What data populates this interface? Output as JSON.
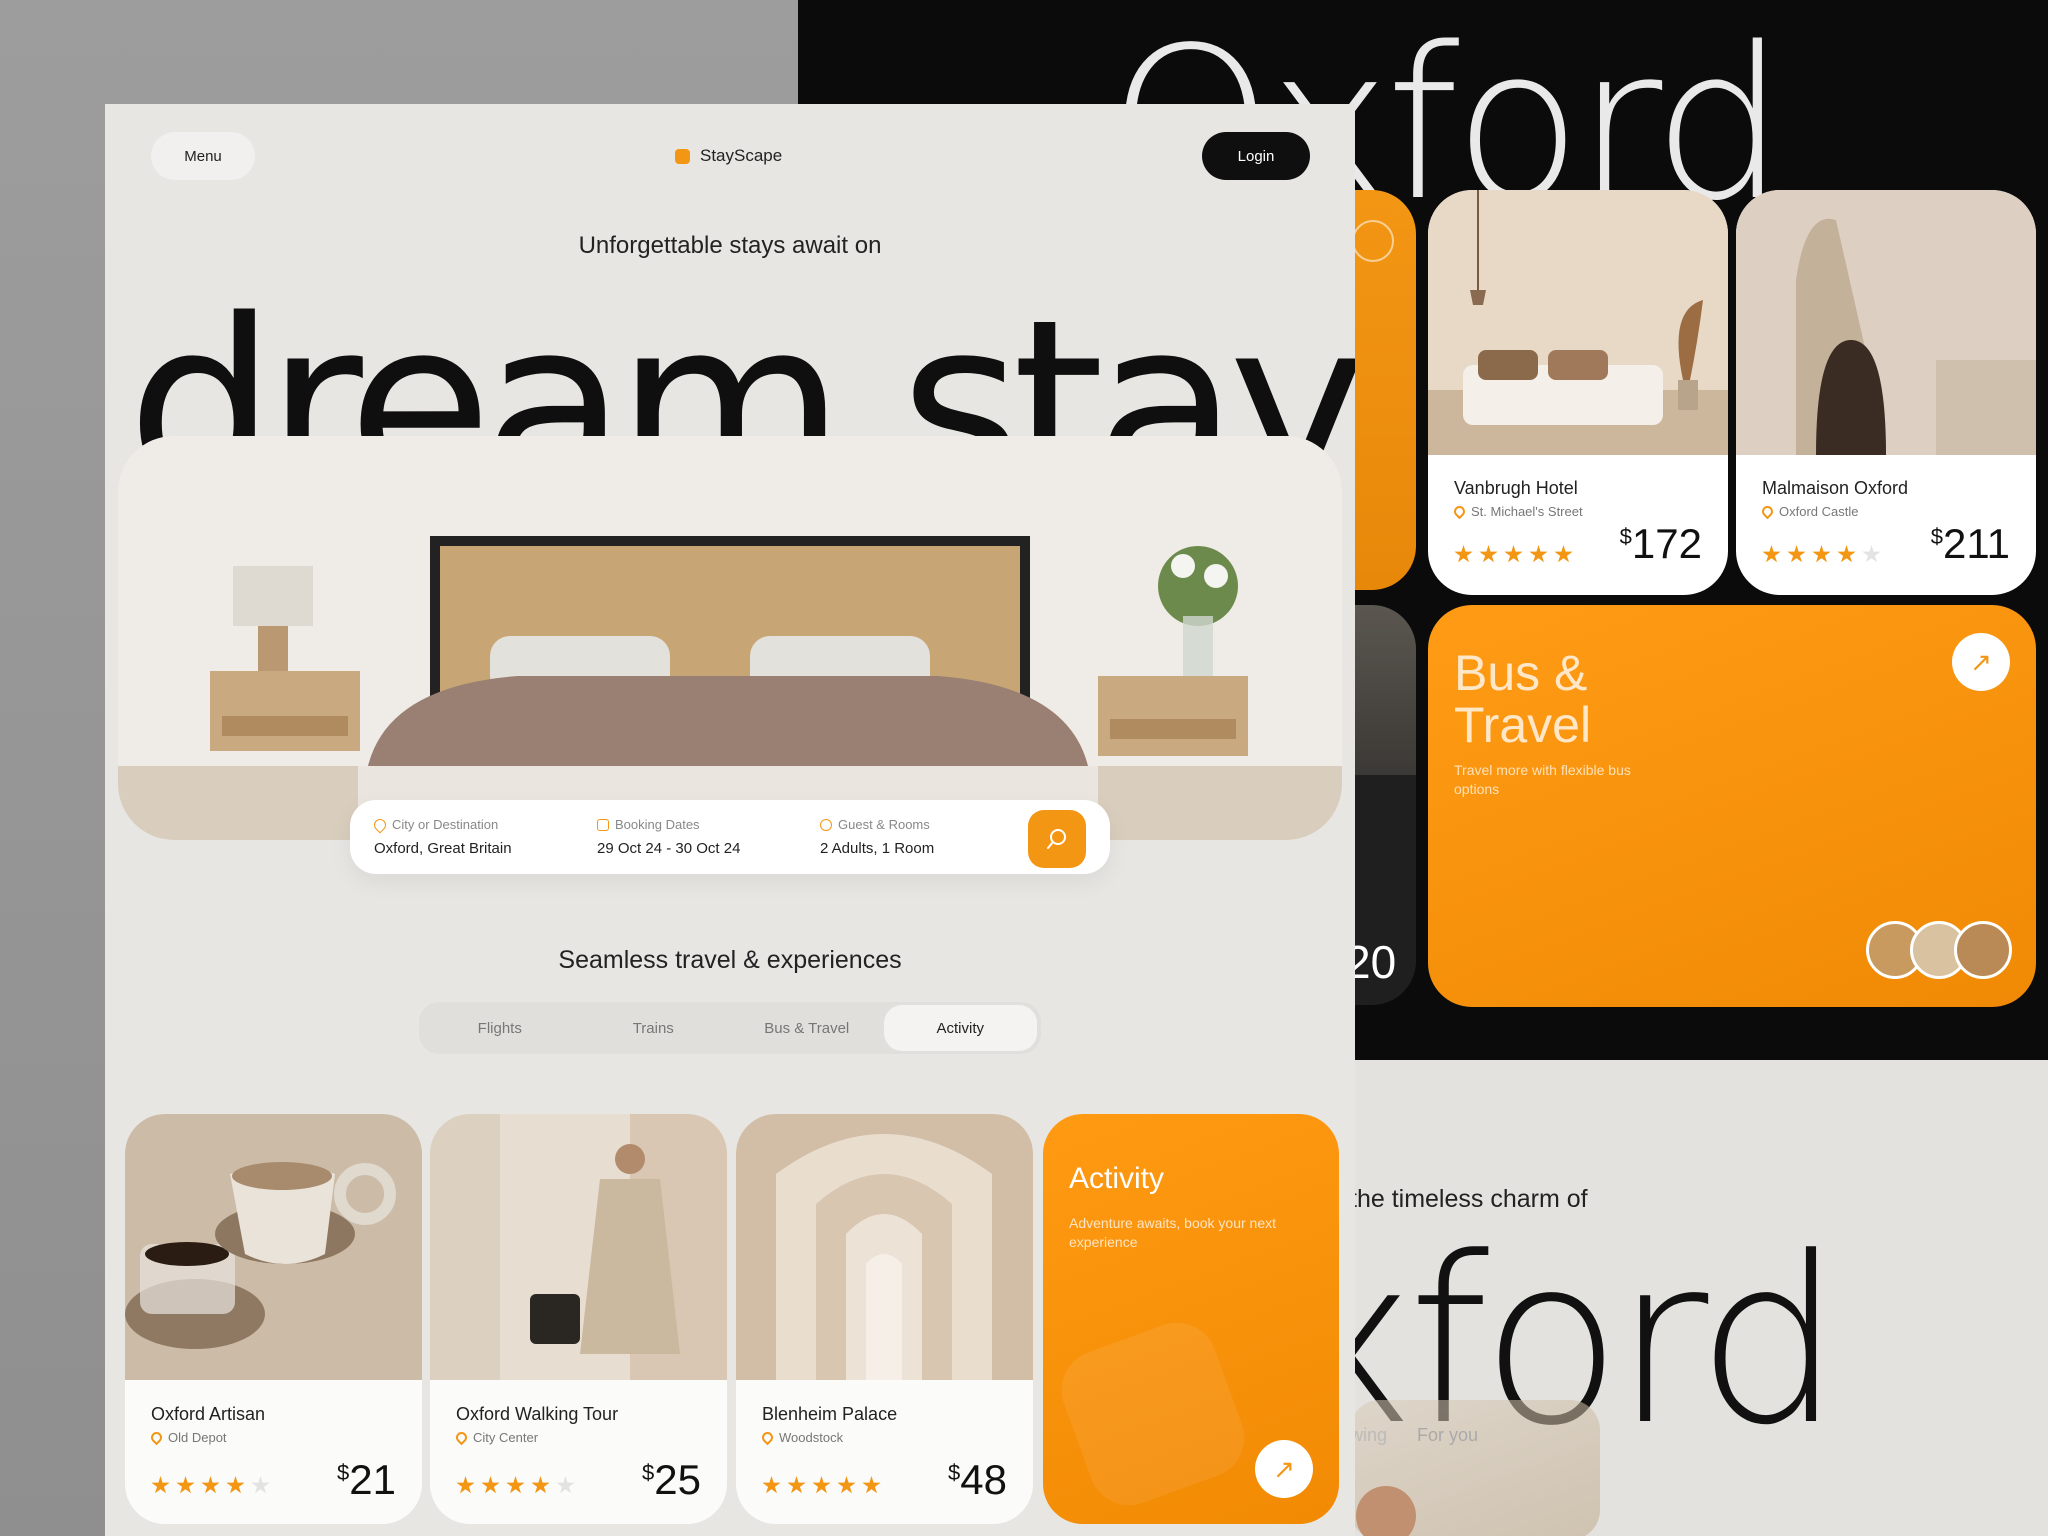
{
  "app": {
    "brand": "StayScape",
    "menu_label": "Menu",
    "login_label": "Login"
  },
  "hero": {
    "subtitle": "Unforgettable stays await on",
    "headline": "dream stay"
  },
  "search": {
    "fields": [
      {
        "label": "City or Destination",
        "value": "Oxford, Great Britain",
        "icon": "location-pin-icon"
      },
      {
        "label": "Booking Dates",
        "value": "29 Oct 24 - 30 Oct 24",
        "icon": "calendar-icon"
      },
      {
        "label": "Guest & Rooms",
        "value": "2 Adults, 1 Room",
        "icon": "people-icon"
      }
    ],
    "button_icon": "search-icon"
  },
  "section": {
    "title": "Seamless travel & experiences"
  },
  "tabs": [
    {
      "label": "Flights",
      "active": false
    },
    {
      "label": "Trains",
      "active": false
    },
    {
      "label": "Bus & Travel",
      "active": false
    },
    {
      "label": "Activity",
      "active": true
    }
  ],
  "activities": [
    {
      "name": "Oxford Artisan",
      "location": "Old Depot",
      "rating": 4,
      "price": "21",
      "currency": "$"
    },
    {
      "name": "Oxford Walking Tour",
      "location": "City Center",
      "rating": 4,
      "price": "25",
      "currency": "$"
    },
    {
      "name": "Blenheim Palace",
      "location": "Woodstock",
      "rating": 5,
      "price": "48",
      "currency": "$"
    }
  ],
  "activity_promo": {
    "title": "Activity",
    "description": "Adventure awaits, book your next experience"
  },
  "background": {
    "headline": "Oxford",
    "hotels": [
      {
        "name": "Vanbrugh Hotel",
        "location": "St. Michael's Street",
        "rating": 5,
        "price": "172",
        "currency": "$"
      },
      {
        "name": "Malmaison Oxford",
        "location": "Oxford Castle",
        "rating": 4,
        "price": "211",
        "currency": "$"
      }
    ],
    "partial_price": "20",
    "bus": {
      "title_line1": "Bus &",
      "title_line2": "Travel",
      "description": "Travel more with flexible bus options"
    },
    "charm_text": "the timeless charm of",
    "headline2": "xford",
    "faint_tabs": [
      "wing",
      "For you"
    ]
  },
  "colors": {
    "accent": "#f39614",
    "dark": "#0b0b0b",
    "page": "#e7e6e3"
  }
}
